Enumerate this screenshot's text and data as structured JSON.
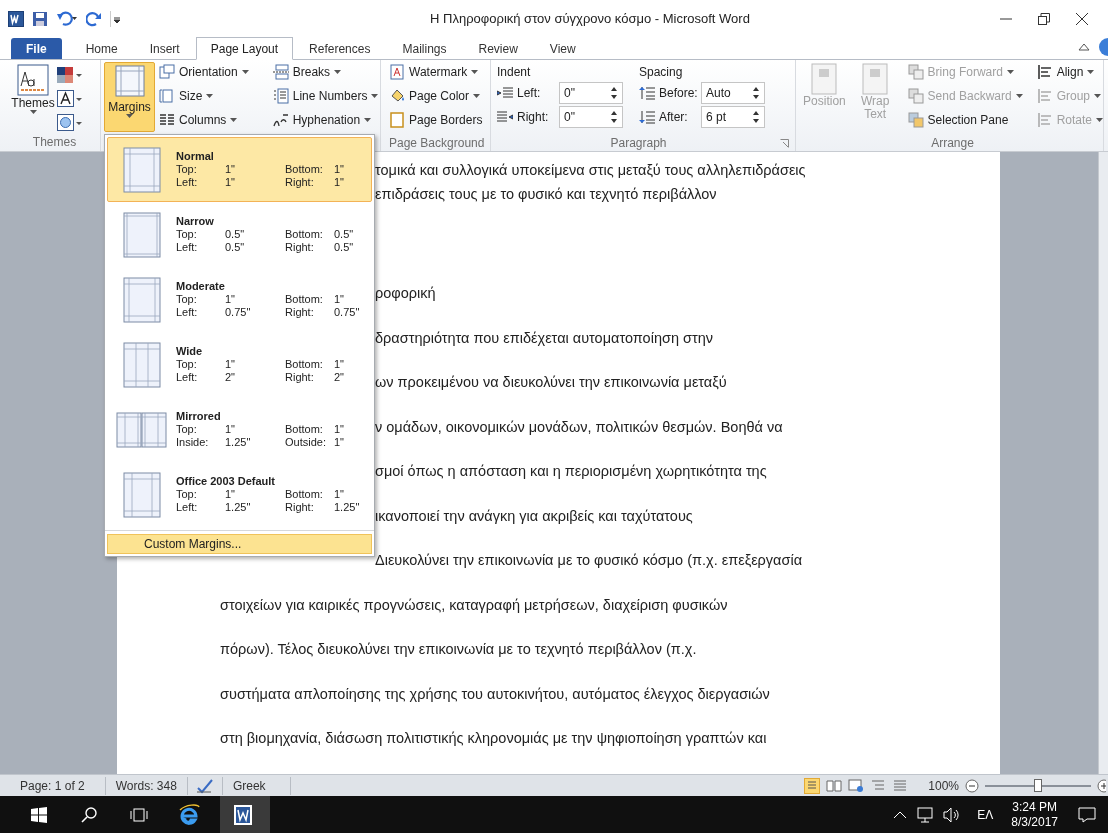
{
  "window": {
    "title": "Η Πληροφορική στον σύγχρονο κόσμο  -  Microsoft Word"
  },
  "tabs": [
    {
      "label": "File",
      "kind": "file",
      "selected": false
    },
    {
      "label": "Home",
      "kind": "tab",
      "selected": false
    },
    {
      "label": "Insert",
      "kind": "tab",
      "selected": false
    },
    {
      "label": "Page Layout",
      "kind": "tab",
      "selected": true
    },
    {
      "label": "References",
      "kind": "tab",
      "selected": false
    },
    {
      "label": "Mailings",
      "kind": "tab",
      "selected": false
    },
    {
      "label": "Review",
      "kind": "tab",
      "selected": false
    },
    {
      "label": "View",
      "kind": "tab",
      "selected": false
    }
  ],
  "ribbon": {
    "themes": {
      "button": "Themes",
      "caption": "Themes"
    },
    "page_setup": {
      "margins": {
        "label": "Margins",
        "expanded": true
      },
      "items": [
        {
          "label": "Orientation",
          "kind": "orientation"
        },
        {
          "label": "Size",
          "kind": "size"
        },
        {
          "label": "Columns",
          "kind": "columns"
        },
        {
          "label": "Breaks",
          "kind": "breaks"
        },
        {
          "label": "Line Numbers",
          "kind": "linenumbers"
        },
        {
          "label": "Hyphenation",
          "kind": "hyphenation"
        }
      ]
    },
    "page_background": {
      "items": [
        {
          "label": "Watermark",
          "kind": "watermark"
        },
        {
          "label": "Page Color",
          "kind": "pagecolor"
        },
        {
          "label": "Page Borders",
          "kind": "pageborders"
        }
      ],
      "caption": "Page Background"
    },
    "paragraph": {
      "indent": "Indent",
      "left": {
        "label": "Left:",
        "value": "0\""
      },
      "right": {
        "label": "Right:",
        "value": "0\""
      },
      "spacing": "Spacing",
      "before": {
        "label": "Before:",
        "value": "Auto"
      },
      "after": {
        "label": "After:",
        "value": "6 pt"
      },
      "caption": "Paragraph"
    },
    "arrange": {
      "position": {
        "label": "Position",
        "disabled": true
      },
      "wrap": {
        "label": "Wrap Text",
        "disabled": true
      },
      "items": [
        {
          "label": "Bring Forward",
          "disabled": true
        },
        {
          "label": "Send Backward",
          "disabled": true
        },
        {
          "label": "Selection Pane",
          "disabled": false
        }
      ],
      "items_2": [
        {
          "label": "Align",
          "disabled": false
        },
        {
          "label": "Group",
          "disabled": true
        },
        {
          "label": "Rotate",
          "disabled": true
        }
      ],
      "caption": "Arrange"
    }
  },
  "margins_menu": {
    "presets": [
      {
        "name": "Normal",
        "kind": "normal",
        "selected": true,
        "rows": [
          [
            "Top:",
            "1\"",
            "Bottom:",
            "1\""
          ],
          [
            "Left:",
            "1\"",
            "Right:",
            "1\""
          ]
        ]
      },
      {
        "name": "Narrow",
        "kind": "narrow",
        "selected": false,
        "rows": [
          [
            "Top:",
            "0.5\"",
            "Bottom:",
            "0.5\""
          ],
          [
            "Left:",
            "0.5\"",
            "Right:",
            "0.5\""
          ]
        ]
      },
      {
        "name": "Moderate",
        "kind": "moderate",
        "selected": false,
        "rows": [
          [
            "Top:",
            "1\"",
            "Bottom:",
            "1\""
          ],
          [
            "Left:",
            "0.75\"",
            "Right:",
            "0.75\""
          ]
        ]
      },
      {
        "name": "Wide",
        "kind": "wide",
        "selected": false,
        "rows": [
          [
            "Top:",
            "1\"",
            "Bottom:",
            "1\""
          ],
          [
            "Left:",
            "2\"",
            "Right:",
            "2\""
          ]
        ]
      },
      {
        "name": "Mirrored",
        "kind": "mirrored",
        "selected": false,
        "rows": [
          [
            "Top:",
            "1\"",
            "Bottom:",
            "1\""
          ],
          [
            "Inside:",
            "1.25\"",
            "Outside:",
            "1\""
          ]
        ]
      },
      {
        "name": "Office 2003 Default",
        "kind": "office2003",
        "selected": false,
        "rows": [
          [
            "Top:",
            "1\"",
            "Bottom:",
            "1\""
          ],
          [
            "Left:",
            "1.25\"",
            "Right:",
            "1.25\""
          ]
        ]
      }
    ],
    "custom": "Custom Margins..."
  },
  "document": {
    "paragraph_1": [
      {
        "text": "τομικά και συλλογικά υποκείμενα στις μεταξύ τους αλληλεπιδράσεις",
        "kind": "clipped"
      },
      {
        "text": "επιδράσεις τους με το φυσικό και τεχνητό περιβάλλον",
        "kind": "clipped"
      }
    ],
    "paragraph_2": [
      {
        "text": "ροφορική",
        "kind": "clipped"
      },
      {
        "text": "δραστηριότητα που επιδέχεται αυτοματοποίηση στην",
        "kind": "clipped"
      },
      {
        "text": "ων προκειμένου  να διευκολύνει την επικοινωνία  μεταξύ",
        "kind": "clipped"
      },
      {
        "text": "ν ομάδων, οικονομικών μονάδων, πολιτικών θεσμών. Βοηθά να",
        "kind": "clipped"
      },
      {
        "text": "σμοί όπως η απόσταση και η περιορισμένη χωρητικότητα της",
        "kind": "clipped"
      },
      {
        "text": "ικανοποιεί την ανάγκη για ακριβείς και ταχύτατους",
        "kind": "clipped"
      },
      {
        "text": "Διευκολύνει την επικοινωνία  με το φυσικό κόσμο (π.χ. επεξεργασία",
        "kind": "clipped"
      },
      {
        "text": "στοιχείων για καιρικές προγνώσεις, καταγραφή μετρήσεων, διαχείριση φυσικών",
        "kind": "full"
      },
      {
        "text": "πόρων). Τέλος διευκολύνει την επικοινωνία  με το τεχνητό περιβάλλον (π.χ.",
        "kind": "full"
      },
      {
        "text": "συστήματα απλοποίησης της χρήσης του αυτοκινήτου, αυτόματος έλεγχος διεργασιών",
        "kind": "full"
      },
      {
        "text": "στη βιομηχανία, διάσωση πολιτιστικής κληρονομιάς με την ψηφιοποίηση γραπτών και",
        "kind": "full"
      }
    ]
  },
  "status_bar": {
    "page": "Page: 1 of 2",
    "words": "Words: 348",
    "language": "Greek",
    "zoom": "100%",
    "zoom_slider": {
      "level": 0.5
    }
  },
  "taskbar": {
    "language": "ΕΛ",
    "time": "3:24 PM",
    "date": "8/3/2017"
  }
}
